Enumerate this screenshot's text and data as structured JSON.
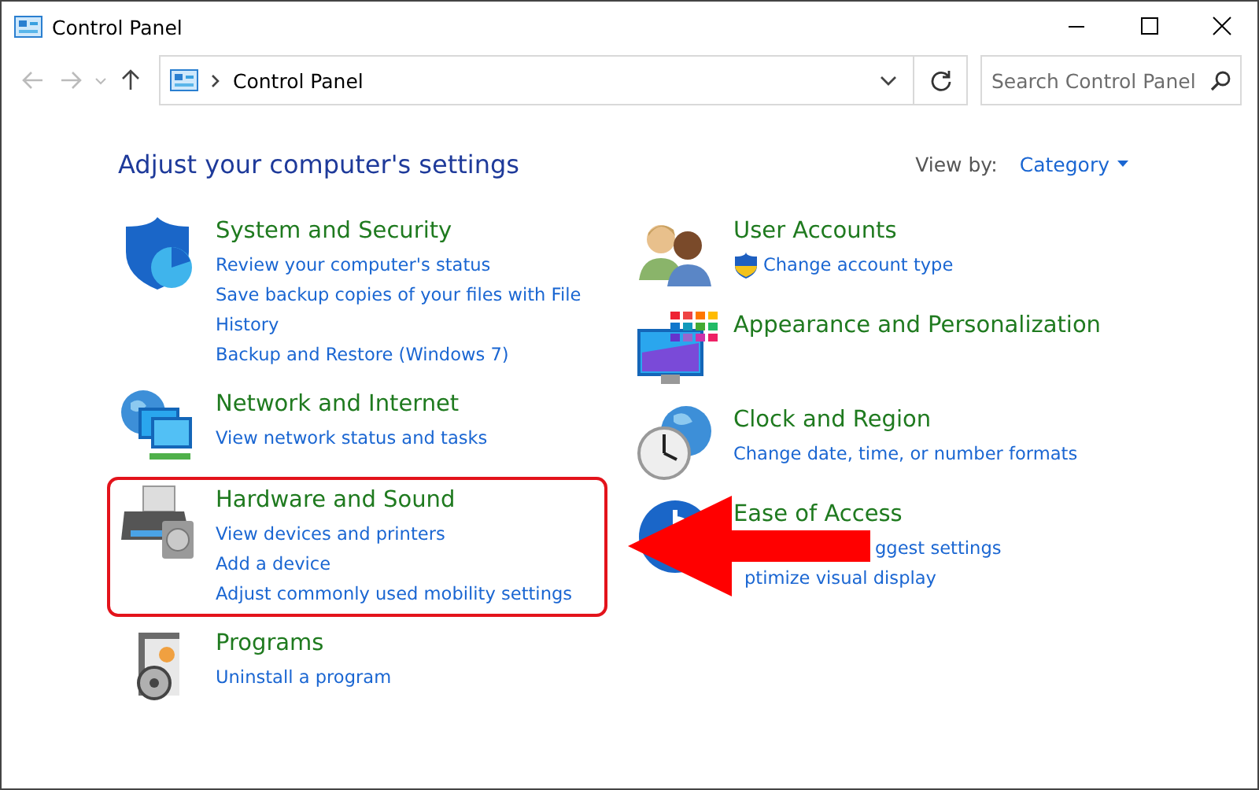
{
  "window": {
    "title": "Control Panel"
  },
  "address_bar": {
    "path": "Control Panel"
  },
  "search": {
    "placeholder": "Search Control Panel"
  },
  "heading": "Adjust your computer's settings",
  "view_by": {
    "label": "View by:",
    "value": "Category"
  },
  "columns": [
    [
      {
        "kind": "security",
        "title": "System and Security",
        "highlighted": false,
        "under_arrow": false,
        "links": [
          {
            "text": "Review your computer's status",
            "shield": false
          },
          {
            "text": "Save backup copies of your files with File History",
            "shield": false
          },
          {
            "text": "Backup and Restore (Windows 7)",
            "shield": false
          }
        ]
      },
      {
        "kind": "network",
        "title": "Network and Internet",
        "highlighted": false,
        "under_arrow": false,
        "links": [
          {
            "text": "View network status and tasks",
            "shield": false
          }
        ]
      },
      {
        "kind": "printer",
        "title": "Hardware and Sound",
        "highlighted": true,
        "under_arrow": false,
        "links": [
          {
            "text": "View devices and printers",
            "shield": false
          },
          {
            "text": "Add a device",
            "shield": false
          },
          {
            "text": "Adjust commonly used mobility settings",
            "shield": false
          }
        ]
      },
      {
        "kind": "programs",
        "title": "Programs",
        "highlighted": false,
        "under_arrow": false,
        "links": [
          {
            "text": "Uninstall a program",
            "shield": false
          }
        ]
      }
    ],
    [
      {
        "kind": "users",
        "title": "User Accounts",
        "highlighted": false,
        "under_arrow": false,
        "links": [
          {
            "text": "Change account type",
            "shield": true
          }
        ]
      },
      {
        "kind": "display",
        "title": "Appearance and Personalization",
        "highlighted": false,
        "under_arrow": false
      },
      {
        "kind": "clock",
        "title": "Clock and Region",
        "highlighted": false,
        "under_arrow": false,
        "links": [
          {
            "text": "Change date, time, or number formats",
            "shield": false
          }
        ]
      },
      {
        "kind": "access",
        "title": "Ease of Access",
        "highlighted": false,
        "under_arrow": true,
        "links": [
          {
            "text": "ggest settings",
            "shield": false
          },
          {
            "text": "ptimize visual display",
            "shield": false
          }
        ]
      }
    ]
  ],
  "annotations": [
    {
      "kind": "arrow"
    }
  ]
}
